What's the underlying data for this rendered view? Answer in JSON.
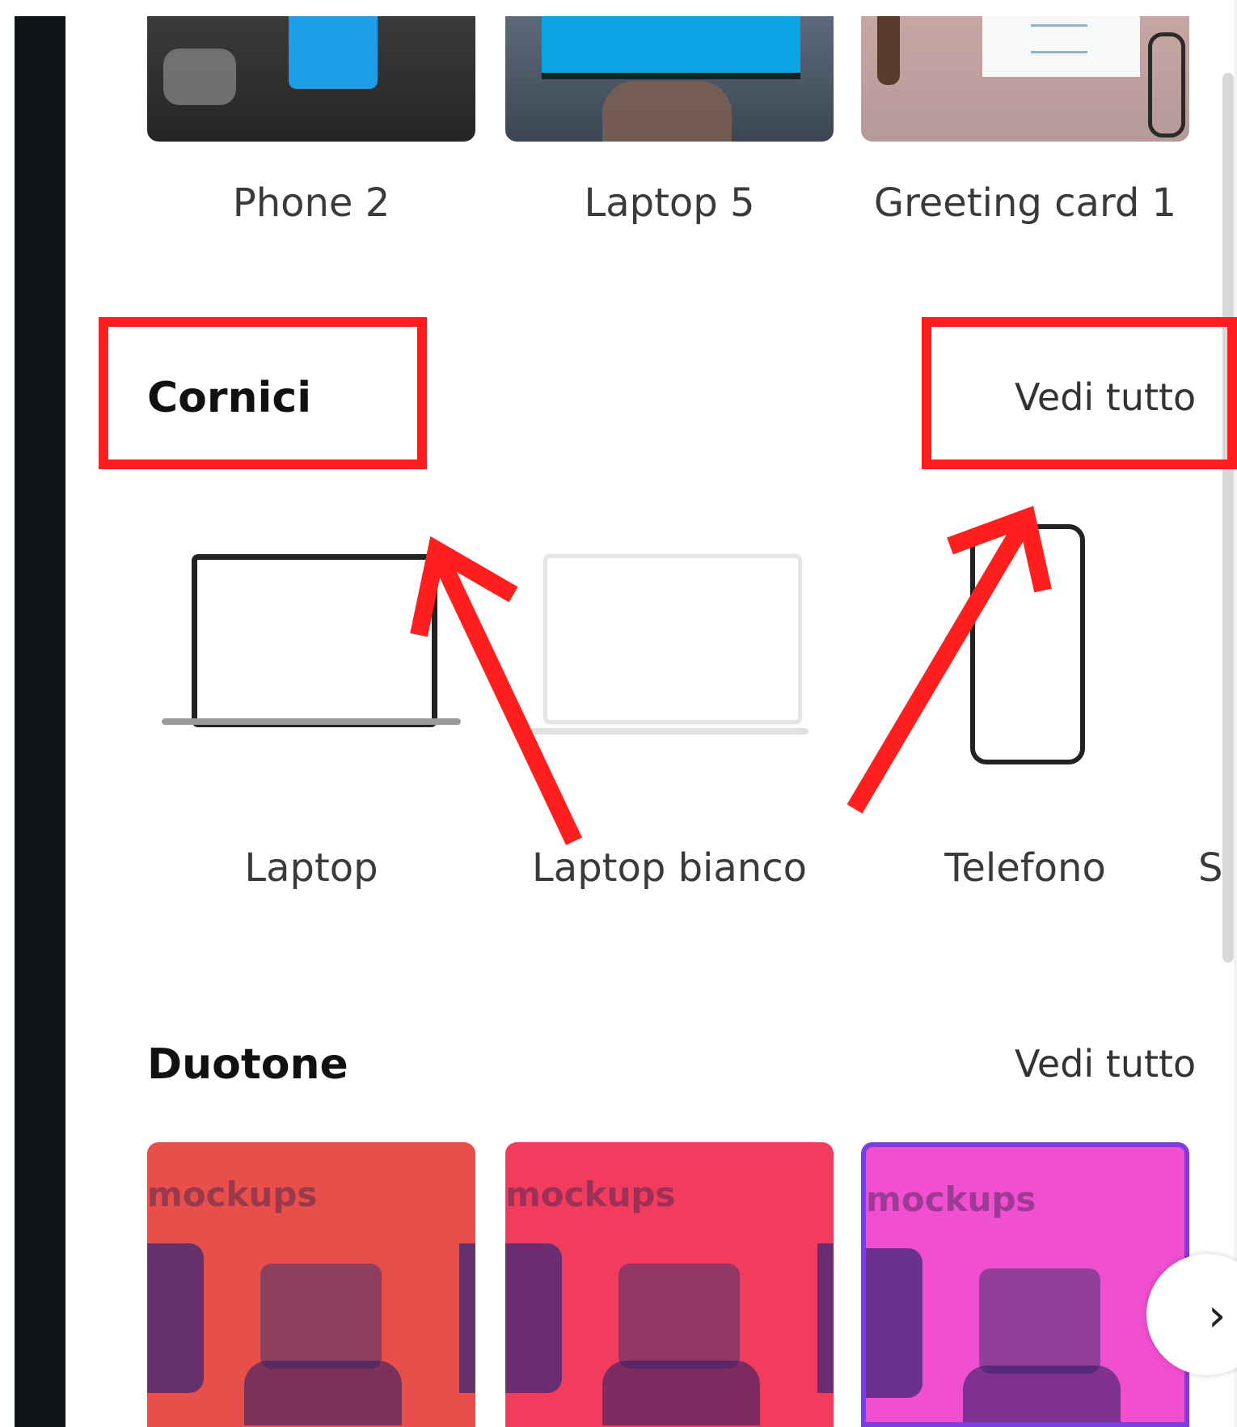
{
  "recent_items": [
    {
      "label": "Phone 2"
    },
    {
      "label": "Laptop 5"
    },
    {
      "label": "Greeting card 1"
    }
  ],
  "frames_section": {
    "title": "Cornici",
    "see_all": "Vedi tutto",
    "items": [
      {
        "label": "Laptop"
      },
      {
        "label": "Laptop bianco"
      },
      {
        "label": "Telefono"
      },
      {
        "label": "S"
      }
    ]
  },
  "duotone_section": {
    "title": "Duotone",
    "see_all": "Vedi tutto",
    "card_text": "mockups",
    "colors": [
      "#e84f4a",
      "#f23c5e",
      "#f04fd0"
    ]
  },
  "annotation_color": "#ff1f1f",
  "next_icon": "chevron-right-icon"
}
